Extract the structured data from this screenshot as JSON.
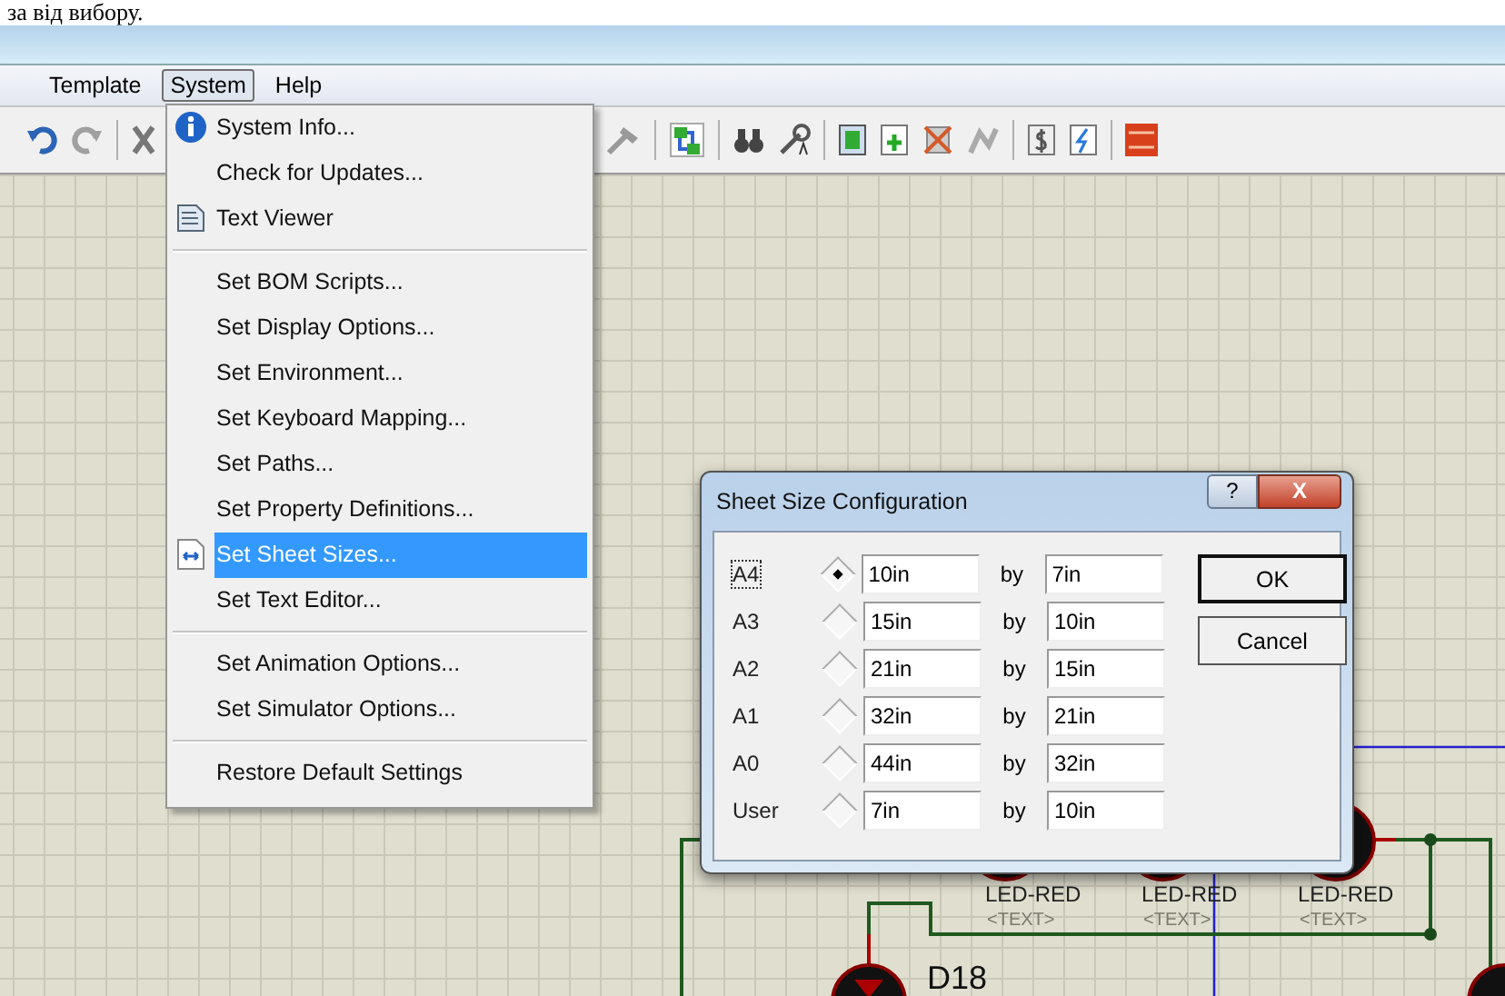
{
  "page_text": "за від вибору.",
  "menu_bar": [
    {
      "label": "Template",
      "selected": false
    },
    {
      "label": "System",
      "selected": true
    },
    {
      "label": "Help",
      "selected": false
    }
  ],
  "system_menu": [
    {
      "kind": "item",
      "label": "System Info...",
      "selected": false
    },
    {
      "kind": "item",
      "label": "Check for Updates...",
      "selected": false
    },
    {
      "kind": "item",
      "label": "Text Viewer",
      "selected": false
    },
    {
      "kind": "separator"
    },
    {
      "kind": "item",
      "label": "Set BOM Scripts...",
      "selected": false
    },
    {
      "kind": "item",
      "label": "Set Display Options...",
      "selected": false
    },
    {
      "kind": "item",
      "label": "Set Environment...",
      "selected": false
    },
    {
      "kind": "item",
      "label": "Set Keyboard Mapping...",
      "selected": false
    },
    {
      "kind": "item",
      "label": "Set Paths...",
      "selected": false
    },
    {
      "kind": "item",
      "label": "Set Property Definitions...",
      "selected": false
    },
    {
      "kind": "item",
      "label": "Set Sheet Sizes...",
      "selected": true
    },
    {
      "kind": "item",
      "label": "Set Text Editor...",
      "selected": false
    },
    {
      "kind": "separator"
    },
    {
      "kind": "item",
      "label": "Set Animation Options...",
      "selected": false
    },
    {
      "kind": "item",
      "label": "Set Simulator Options...",
      "selected": false
    },
    {
      "kind": "separator"
    },
    {
      "kind": "item",
      "label": "Restore Default Settings",
      "selected": false
    }
  ],
  "dialog": {
    "title": "Sheet Size Configuration",
    "help_button": "?",
    "close_button": "X",
    "rows": [
      {
        "label": "A4",
        "selected": true,
        "width": "10in",
        "by": "by",
        "height": "7in"
      },
      {
        "label": "A3",
        "selected": false,
        "width": "15in",
        "by": "by",
        "height": "10in"
      },
      {
        "label": "A2",
        "selected": false,
        "width": "21in",
        "by": "by",
        "height": "15in"
      },
      {
        "label": "A1",
        "selected": false,
        "width": "32in",
        "by": "by",
        "height": "21in"
      },
      {
        "label": "A0",
        "selected": false,
        "width": "44in",
        "by": "by",
        "height": "32in"
      },
      {
        "label": "User",
        "selected": false,
        "width": "7in",
        "by": "by",
        "height": "10in"
      }
    ],
    "buttons": [
      "OK",
      "Cancel"
    ]
  },
  "schematic": {
    "parts": [
      {
        "value": "LED-RED",
        "text": "<TEXT>"
      },
      {
        "value": "LED-RED",
        "text": "<TEXT>"
      },
      {
        "value": "LED-RED",
        "text": "<TEXT>"
      }
    ],
    "designator": "D18"
  }
}
